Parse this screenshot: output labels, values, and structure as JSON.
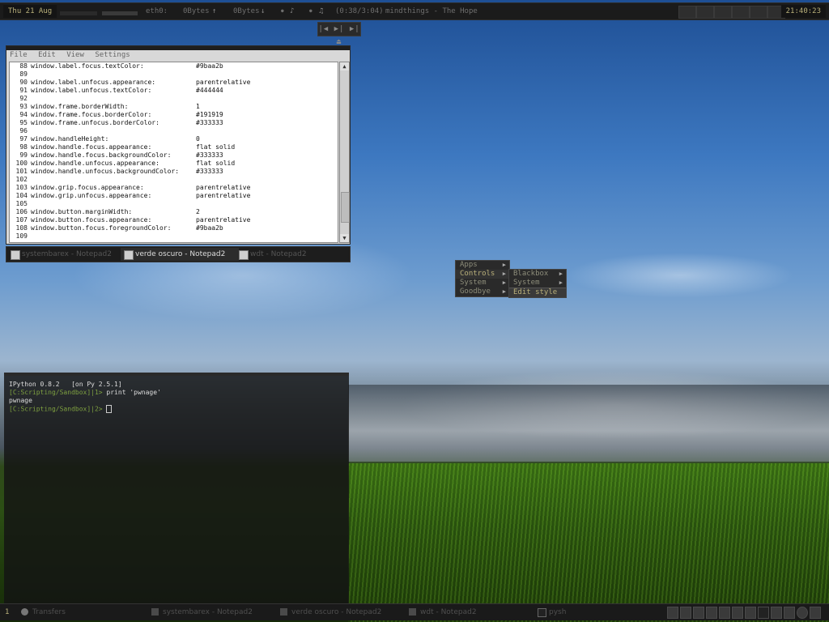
{
  "topbar": {
    "date": "Thu 21 Aug",
    "net_iface": "eth0:",
    "up_rate": "0Bytes",
    "down_rate": "0Bytes",
    "track_time": "(0:38/3:04)",
    "track_title": "mindthings - The Hope",
    "clock": "21:40:23"
  },
  "icons": {
    "up": "↑",
    "down": "↓",
    "speaker": "♪",
    "note": "♫",
    "media_controls": "|◀ ▶| ▶| ⏏"
  },
  "notepad": {
    "menu": [
      "File",
      "Edit",
      "View",
      "Settings"
    ],
    "lines": [
      {
        "n": "88",
        "key": "window.label.focus.textColor:",
        "val": "#9baa2b"
      },
      {
        "n": "89",
        "key": "",
        "val": ""
      },
      {
        "n": "90",
        "key": "window.label.unfocus.appearance:",
        "val": "parentrelative"
      },
      {
        "n": "91",
        "key": "window.label.unfocus.textColor:",
        "val": "#444444"
      },
      {
        "n": "92",
        "key": "",
        "val": ""
      },
      {
        "n": "93",
        "key": "window.frame.borderWidth:",
        "val": "1"
      },
      {
        "n": "94",
        "key": "window.frame.focus.borderColor:",
        "val": "#191919"
      },
      {
        "n": "95",
        "key": "window.frame.unfocus.borderColor:",
        "val": "#333333"
      },
      {
        "n": "96",
        "key": "",
        "val": ""
      },
      {
        "n": "97",
        "key": "window.handleHeight:",
        "val": "0"
      },
      {
        "n": "98",
        "key": "window.handle.focus.appearance:",
        "val": "flat solid"
      },
      {
        "n": "99",
        "key": "window.handle.focus.backgroundColor:",
        "val": "#333333"
      },
      {
        "n": "100",
        "key": "window.handle.unfocus.appearance:",
        "val": "flat solid"
      },
      {
        "n": "101",
        "key": "window.handle.unfocus.backgroundColor:",
        "val": "#333333"
      },
      {
        "n": "102",
        "key": "",
        "val": ""
      },
      {
        "n": "103",
        "key": "window.grip.focus.appearance:",
        "val": "parentrelative"
      },
      {
        "n": "104",
        "key": "window.grip.unfocus.appearance:",
        "val": "parentrelative"
      },
      {
        "n": "105",
        "key": "",
        "val": ""
      },
      {
        "n": "106",
        "key": "window.button.marginWidth:",
        "val": "2"
      },
      {
        "n": "107",
        "key": "window.button.focus.appearance:",
        "val": "parentrelative"
      },
      {
        "n": "108",
        "key": "window.button.focus.foregroundColor:",
        "val": "#9baa2b"
      },
      {
        "n": "109",
        "key": "",
        "val": ""
      }
    ]
  },
  "tabs": [
    {
      "label": "systembarex - Notepad2",
      "active": false
    },
    {
      "label": "verde oscuro - Notepad2",
      "active": true
    },
    {
      "label": "wdt - Notepad2",
      "active": false
    }
  ],
  "rootmenu": {
    "items": [
      "Apps",
      "Controls",
      "System",
      "Goodbye"
    ],
    "selected": "Controls"
  },
  "submenu": {
    "items": [
      "Blackbox",
      "System"
    ],
    "highlighted": "Edit style"
  },
  "terminal": {
    "line1": "IPython 0.8.2   [on Py 2.5.1]",
    "prompt1": "[C:Scripting/Sandbox]|1> ",
    "cmd1": "print 'pwnage'",
    "output1": "pwnage",
    "prompt2": "[C:Scripting/Sandbox]|2> "
  },
  "taskbar": {
    "workspace": "1",
    "items": [
      "Transfers",
      "systembarex - Notepad2",
      "verde oscuro - Notepad2",
      "wdt - Notepad2",
      "pysh"
    ]
  },
  "colors": {
    "accent": "#b9b07a",
    "prompt": "#7ea040",
    "bar_bg": "#1b1b1b"
  }
}
